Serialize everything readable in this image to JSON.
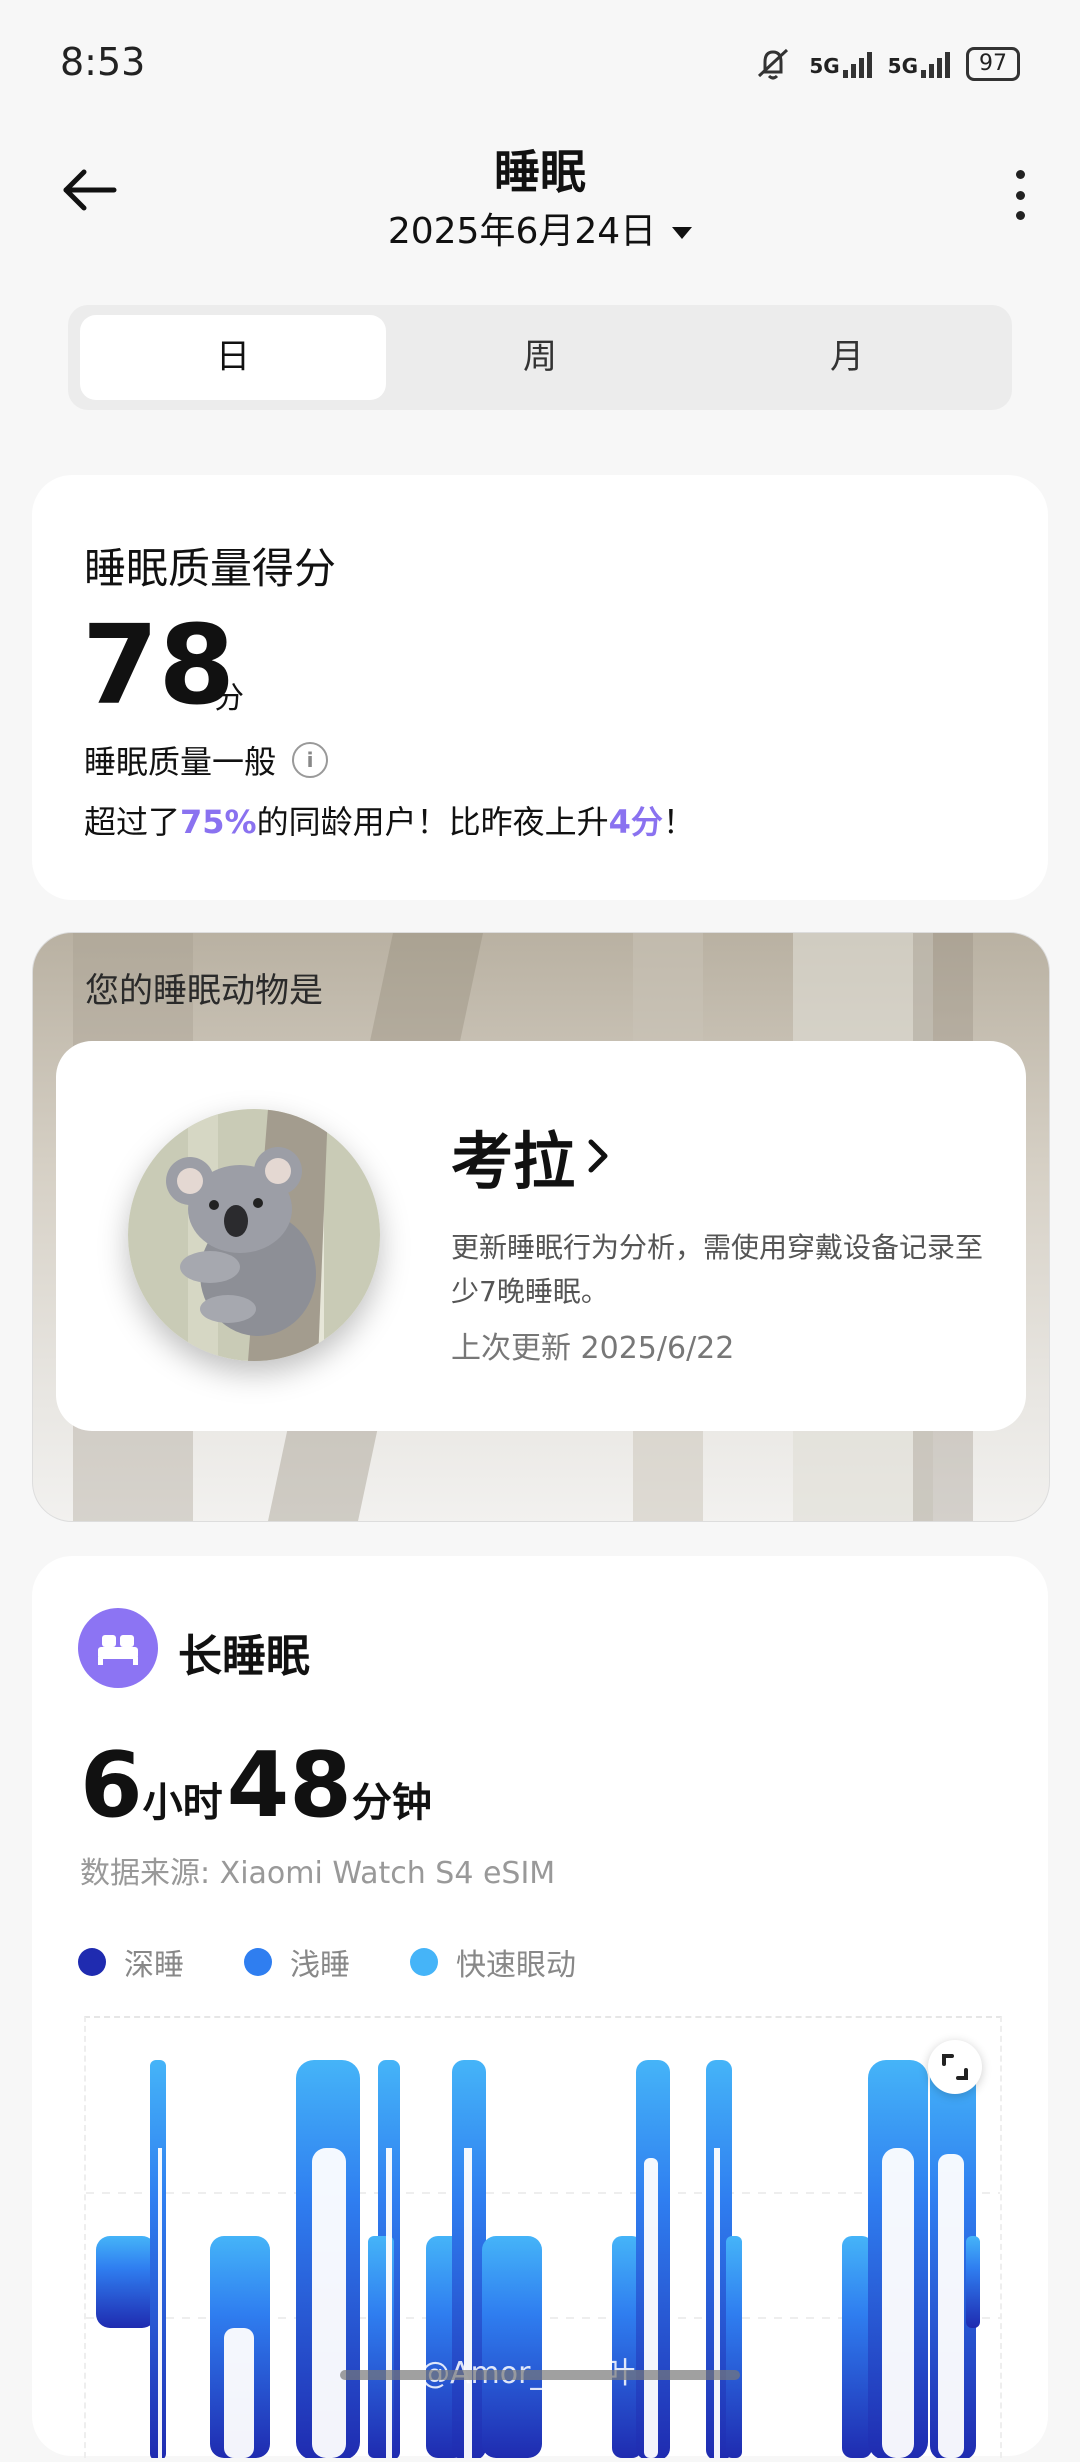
{
  "status_bar": {
    "time": "8:53",
    "network_1": "5G",
    "network_2": "5G",
    "battery": "97"
  },
  "header": {
    "title": "睡眠",
    "date": "2025年6月24日"
  },
  "tabs": [
    {
      "label": "日",
      "active": true
    },
    {
      "label": "周",
      "active": false
    },
    {
      "label": "月",
      "active": false
    }
  ],
  "score_card": {
    "title": "睡眠质量得分",
    "score": "78",
    "unit": "分",
    "quality_label": "睡眠质量一般",
    "compare_prefix": "超过了",
    "compare_percent": "75%",
    "compare_mid": "的同龄用户！比昨夜上升",
    "compare_delta": "4分",
    "compare_suffix": "！"
  },
  "animal_card": {
    "heading": "您的睡眠动物是",
    "name": "考拉",
    "description": "更新睡眠行为分析，需使用穿戴设备记录至少7晚睡眠。",
    "updated": "上次更新 2025/6/22"
  },
  "sleep_card": {
    "title": "长睡眠",
    "hours": "6",
    "hours_unit": "小时",
    "minutes": "48",
    "minutes_unit": "分钟",
    "source": "数据来源: Xiaomi Watch S4 eSIM",
    "legend": [
      {
        "label": "深睡",
        "color": "#1f2bb0"
      },
      {
        "label": "浅睡",
        "color": "#2f7ef0"
      },
      {
        "label": "快速眼动",
        "color": "#45b4f8"
      }
    ]
  },
  "watermark": "@Amor_叶叶叶",
  "colors": {
    "accent": "#8a72f0",
    "deep": "#1f2bb0",
    "light": "#2f7ef0",
    "rem": "#45b4f8"
  }
}
